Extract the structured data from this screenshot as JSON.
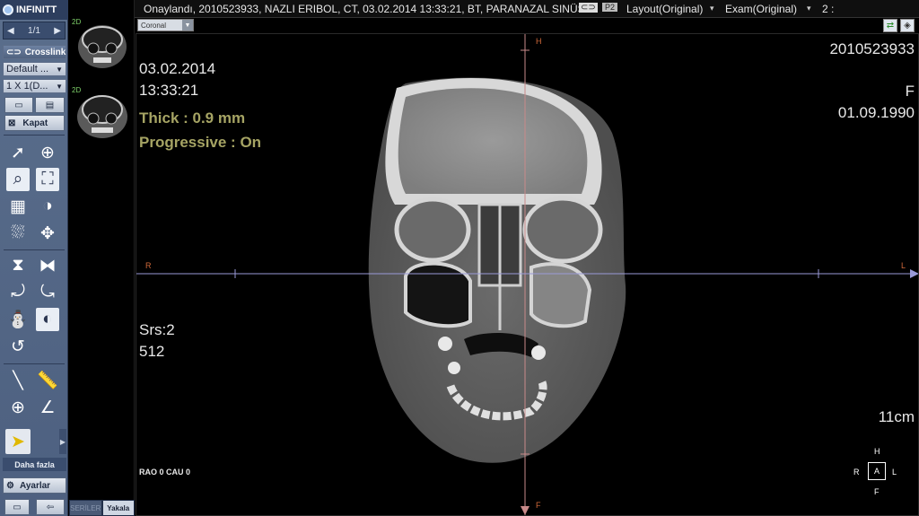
{
  "app": {
    "logo": "INFINITT"
  },
  "toolbar": {
    "pager": "1/1",
    "crosslink": "Crosslink",
    "preset": "Default ...",
    "layout": "1 X 1(D...",
    "close": "Kapat",
    "more": "Daha fazla",
    "settings": "Ayarlar"
  },
  "series": {
    "thumbs": [
      {
        "label": "2D"
      },
      {
        "label": "2D"
      }
    ],
    "tabs": [
      "SERİLER",
      "Yakala"
    ]
  },
  "topbar": {
    "title": "Onaylandı, 2010523933, NAZLI ERIBOL, CT, 03.02.2014 13:33:21, BT, PARANAZAL SINÜS",
    "layout": "Layout(Original)",
    "exam": "Exam(Original)",
    "count": "2 :"
  },
  "view": {
    "plane": "Coronal"
  },
  "overlay": {
    "date": "03.02.2014",
    "time": "13:33:21",
    "thick": "Thick : 0.9 mm",
    "progressive": "Progressive : On",
    "series": "Srs:2",
    "matrix": "512",
    "rao": "RAO 0 CAU 0",
    "patient_id": "2010523933",
    "sex": "F",
    "dob": "01.09.1990",
    "scale": "11cm",
    "orient": {
      "top": "H",
      "bottom": "F",
      "left": "R",
      "right": "L",
      "center": "A"
    }
  },
  "colors": {
    "overlay_yellow": "#a6a464",
    "crosshair_v": "#c98a8a",
    "crosshair_h": "#9a9ad8"
  }
}
